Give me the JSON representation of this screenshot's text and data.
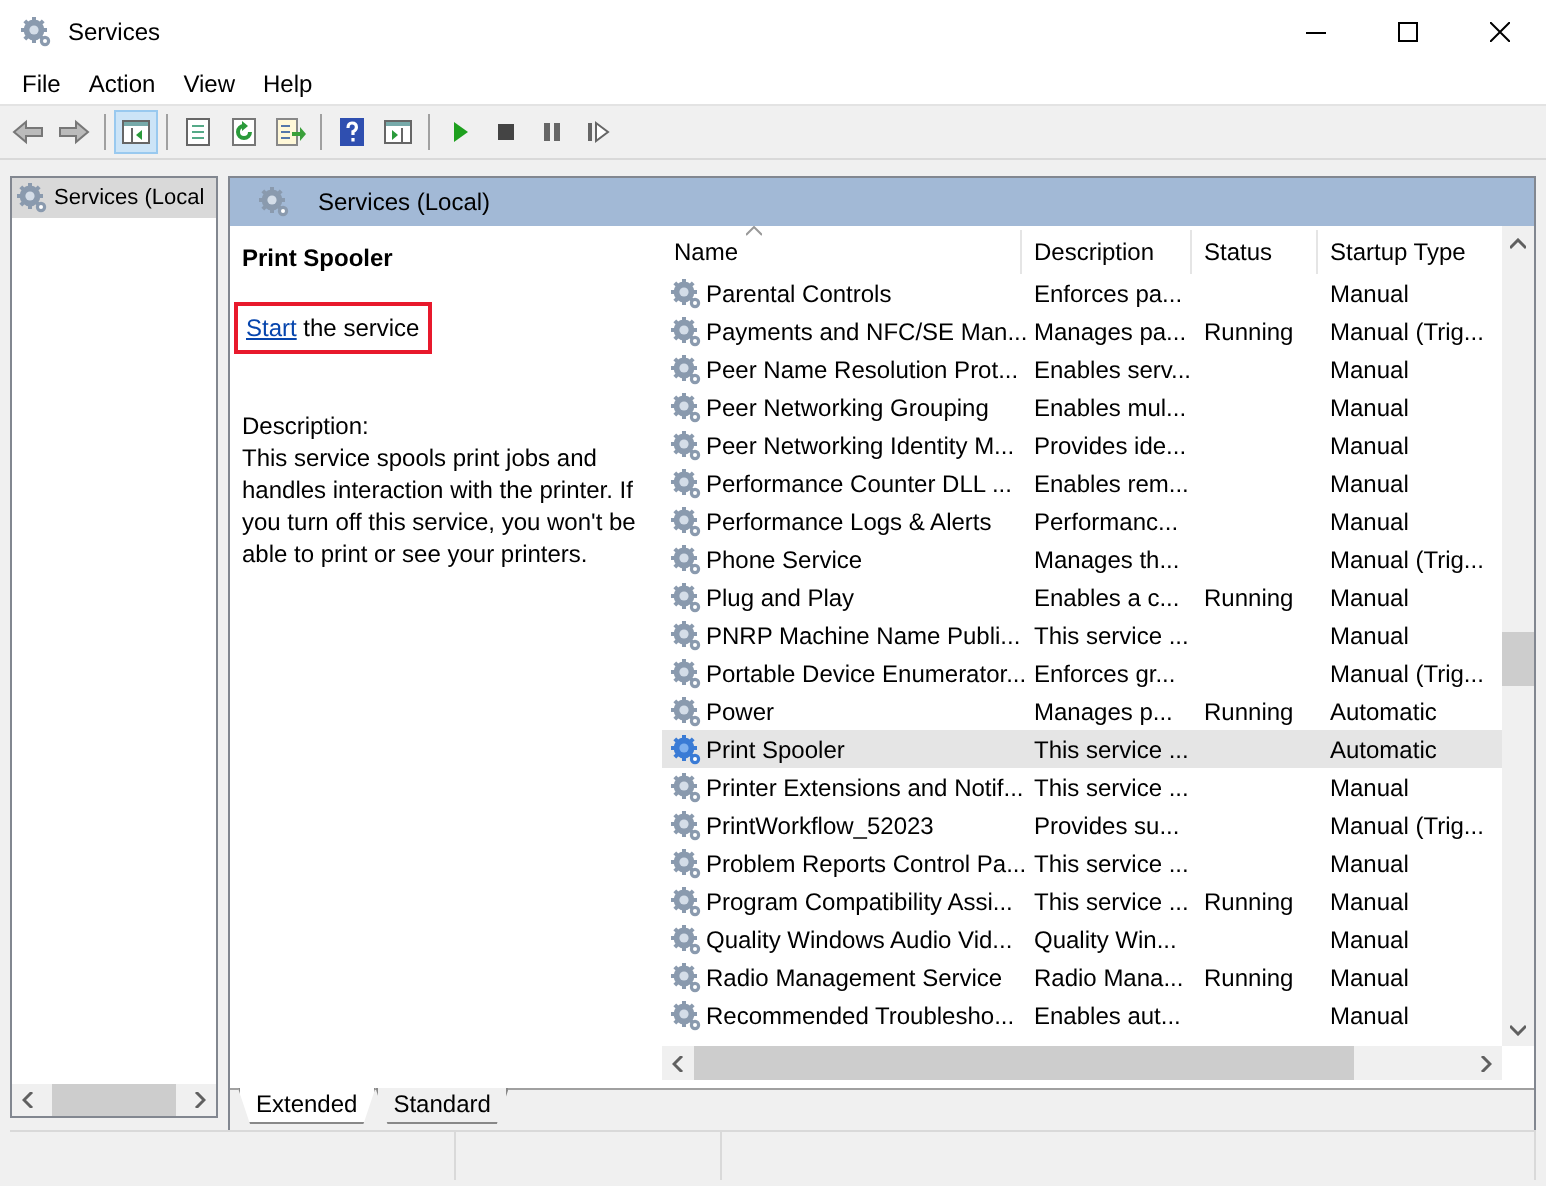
{
  "window": {
    "title": "Services"
  },
  "menu": [
    "File",
    "Action",
    "View",
    "Help"
  ],
  "tree": {
    "items": [
      {
        "label": "Services (Local",
        "selected": true
      }
    ]
  },
  "panel": {
    "title": "Services (Local)"
  },
  "details": {
    "title": "Print Spooler",
    "action": {
      "link": "Start",
      "text": " the service",
      "highlighted": true
    },
    "description_label": "Description:",
    "description": "This service spools print jobs and handles interaction with the printer. If you turn off this service, you won't be able to print or see your printers."
  },
  "table": {
    "columns": [
      "Name",
      "Description",
      "Status",
      "Startup Type"
    ],
    "rows": [
      {
        "name": "Parental Controls",
        "description": "Enforces pa...",
        "status": "",
        "startup": "Manual",
        "selected": false
      },
      {
        "name": "Payments and NFC/SE Man...",
        "description": "Manages pa...",
        "status": "Running",
        "startup": "Manual (Trig...",
        "selected": false
      },
      {
        "name": "Peer Name Resolution Prot...",
        "description": "Enables serv...",
        "status": "",
        "startup": "Manual",
        "selected": false
      },
      {
        "name": "Peer Networking Grouping",
        "description": "Enables mul...",
        "status": "",
        "startup": "Manual",
        "selected": false
      },
      {
        "name": "Peer Networking Identity M...",
        "description": "Provides ide...",
        "status": "",
        "startup": "Manual",
        "selected": false
      },
      {
        "name": "Performance Counter DLL ...",
        "description": "Enables rem...",
        "status": "",
        "startup": "Manual",
        "selected": false
      },
      {
        "name": "Performance Logs & Alerts",
        "description": "Performanc...",
        "status": "",
        "startup": "Manual",
        "selected": false
      },
      {
        "name": "Phone Service",
        "description": "Manages th...",
        "status": "",
        "startup": "Manual (Trig...",
        "selected": false
      },
      {
        "name": "Plug and Play",
        "description": "Enables a c...",
        "status": "Running",
        "startup": "Manual",
        "selected": false
      },
      {
        "name": "PNRP Machine Name Publi...",
        "description": "This service ...",
        "status": "",
        "startup": "Manual",
        "selected": false
      },
      {
        "name": "Portable Device Enumerator...",
        "description": "Enforces gr...",
        "status": "",
        "startup": "Manual (Trig...",
        "selected": false
      },
      {
        "name": "Power",
        "description": "Manages p...",
        "status": "Running",
        "startup": "Automatic",
        "selected": false
      },
      {
        "name": "Print Spooler",
        "description": "This service ...",
        "status": "",
        "startup": "Automatic",
        "selected": true
      },
      {
        "name": "Printer Extensions and Notif...",
        "description": "This service ...",
        "status": "",
        "startup": "Manual",
        "selected": false
      },
      {
        "name": "PrintWorkflow_52023",
        "description": "Provides su...",
        "status": "",
        "startup": "Manual (Trig...",
        "selected": false
      },
      {
        "name": "Problem Reports Control Pa...",
        "description": "This service ...",
        "status": "",
        "startup": "Manual",
        "selected": false
      },
      {
        "name": "Program Compatibility Assi...",
        "description": "This service ...",
        "status": "Running",
        "startup": "Manual",
        "selected": false
      },
      {
        "name": "Quality Windows Audio Vid...",
        "description": "Quality Win...",
        "status": "",
        "startup": "Manual",
        "selected": false
      },
      {
        "name": "Radio Management Service",
        "description": "Radio Mana...",
        "status": "Running",
        "startup": "Manual",
        "selected": false
      },
      {
        "name": "Recommended Troublesho...",
        "description": "Enables aut...",
        "status": "",
        "startup": "Manual",
        "selected": false
      }
    ]
  },
  "tabs": [
    {
      "label": "Extended",
      "selected": true
    },
    {
      "label": "Standard",
      "selected": false
    }
  ]
}
